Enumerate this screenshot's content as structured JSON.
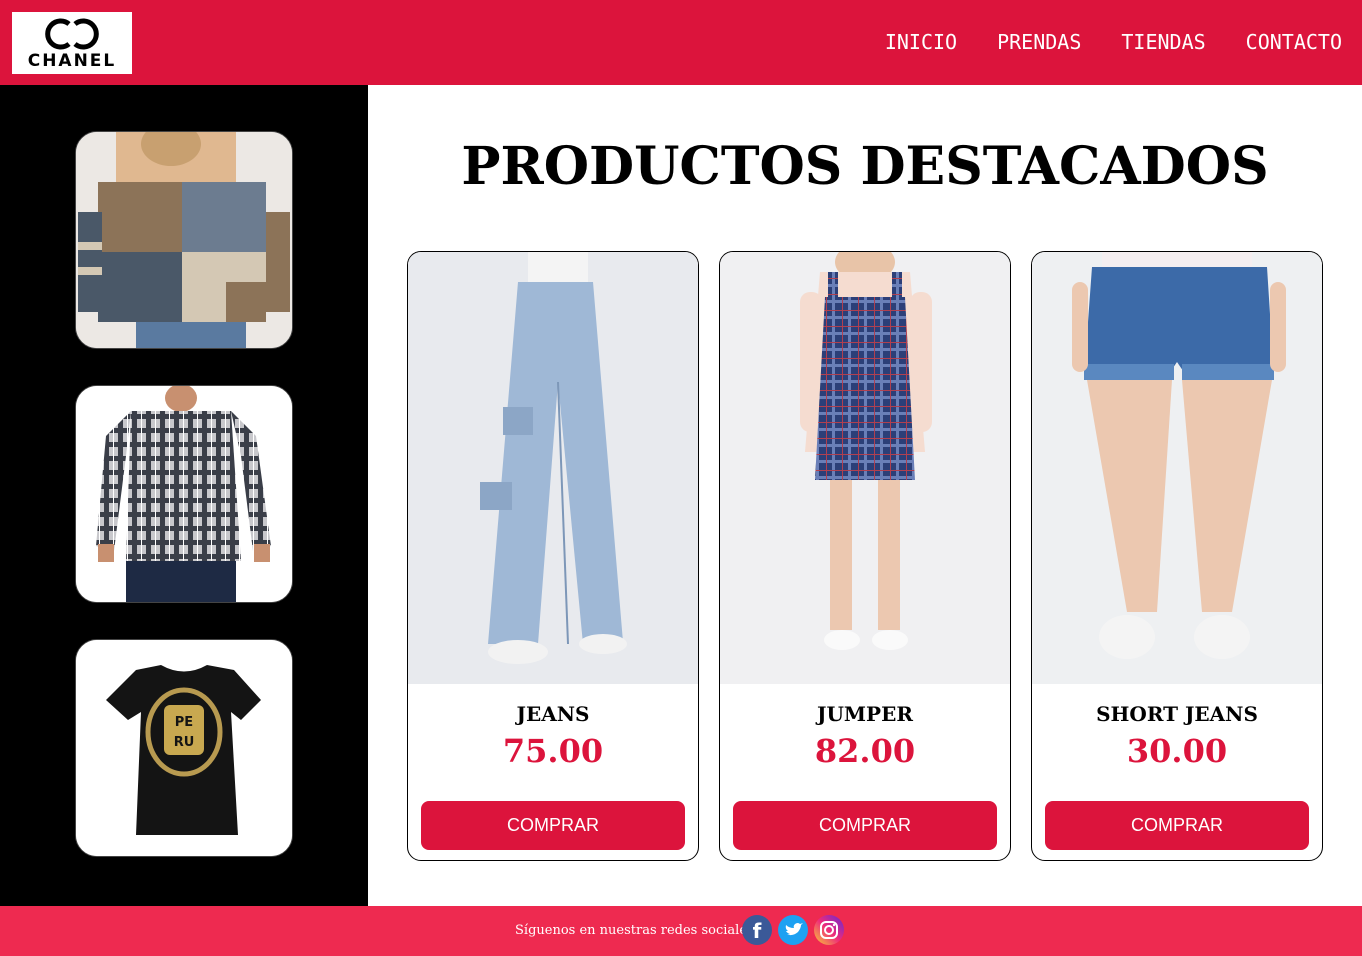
{
  "brand": {
    "logo_text": "CHANEL",
    "color": "#dc143c"
  },
  "nav": {
    "items": [
      "INICIO",
      "PRENDAS",
      "TIENDAS",
      "CONTACTO"
    ]
  },
  "sidebar": {
    "items": [
      {
        "icon": "sweater-image"
      },
      {
        "icon": "plaid-shirt-image"
      },
      {
        "icon": "peru-tshirt-image"
      }
    ]
  },
  "main": {
    "title": "PRODUCTOS DESTACADOS"
  },
  "products": [
    {
      "name": "JEANS",
      "price": "75.00",
      "button": "COMPRAR"
    },
    {
      "name": "JUMPER",
      "price": "82.00",
      "button": "COMPRAR"
    },
    {
      "name": "SHORT JEANS",
      "price": "30.00",
      "button": "COMPRAR"
    }
  ],
  "footer": {
    "follow_text": "Síguenos en nuestras redes sociales:",
    "social": [
      "facebook-icon",
      "twitter-icon",
      "instagram-icon"
    ],
    "color": "#ee2a50"
  }
}
